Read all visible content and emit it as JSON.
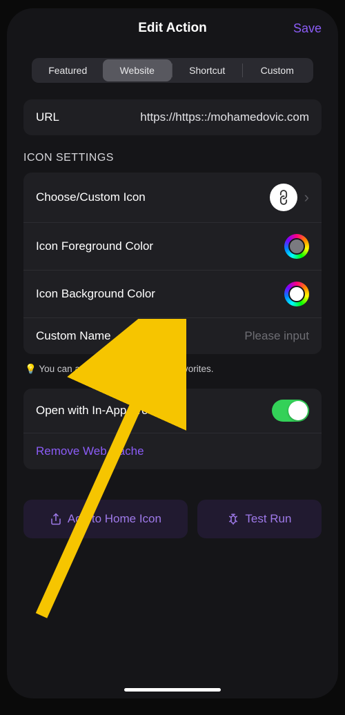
{
  "header": {
    "title": "Edit Action",
    "save_label": "Save"
  },
  "tabs": {
    "featured": "Featured",
    "website": "Website",
    "shortcut": "Shortcut",
    "custom": "Custom",
    "active": "Website"
  },
  "url_field": {
    "label": "URL",
    "value": "https://https::/mohamedovic.com"
  },
  "icon_settings": {
    "heading": "ICON SETTINGS",
    "choose_icon_label": "Choose/Custom Icon",
    "foreground_label": "Icon Foreground Color",
    "background_label": "Icon Background Color",
    "custom_name_label": "Custom Name",
    "custom_name_placeholder": "Please input",
    "foreground_color": "#7a7a80",
    "background_color": "#ffffff"
  },
  "hint_text": "💡 You can add any website to your favorites.",
  "browser": {
    "open_label": "Open with In-App Browser",
    "toggle_on": true,
    "remove_cache_label": "Remove Web Cache"
  },
  "actions": {
    "add_home": "Add to Home Icon",
    "test_run": "Test Run"
  }
}
